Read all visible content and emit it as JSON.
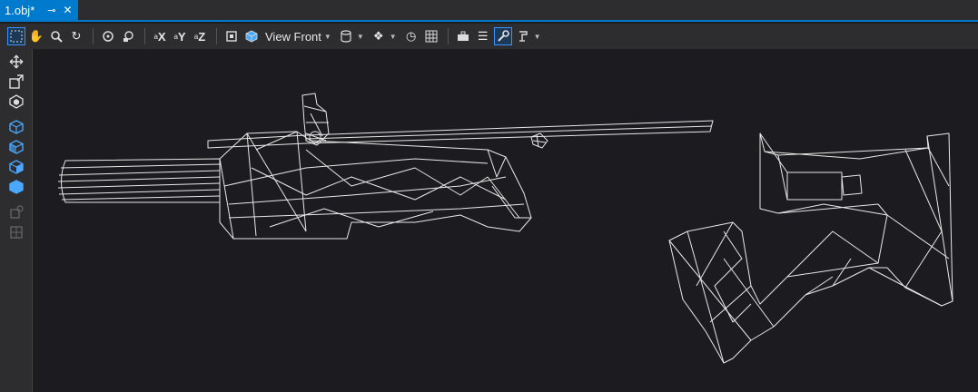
{
  "tab": {
    "title": "1.obj*",
    "pin": "⊸",
    "close": "✕"
  },
  "toolbar": {
    "view_label": "View Front",
    "axis_x": "X",
    "axis_y": "Y",
    "axis_z": "Z",
    "colors": {
      "accent": "#007acc",
      "active_border": "#3794ff",
      "icon_blue": "#4aa8ff"
    }
  },
  "toolbar_icons": [
    "select-rect-icon",
    "hand-icon",
    "zoom-icon",
    "rotate-icon",
    "orbit-icon",
    "light-icon",
    "axis-x-icon",
    "axis-y-icon",
    "axis-z-icon",
    "fit-icon",
    "cube-view-icon",
    "database-icon",
    "layers-icon",
    "history-icon",
    "grid-icon",
    "toolbox-icon",
    "list-icon",
    "wrench-icon",
    "paint-icon"
  ],
  "sidebar_icons": [
    "move-icon",
    "scale-icon",
    "mesh-icon",
    "cube-1-icon",
    "cube-2-icon",
    "cube-3-icon",
    "cube-4-icon",
    "disabled-1-icon",
    "disabled-2-icon"
  ]
}
